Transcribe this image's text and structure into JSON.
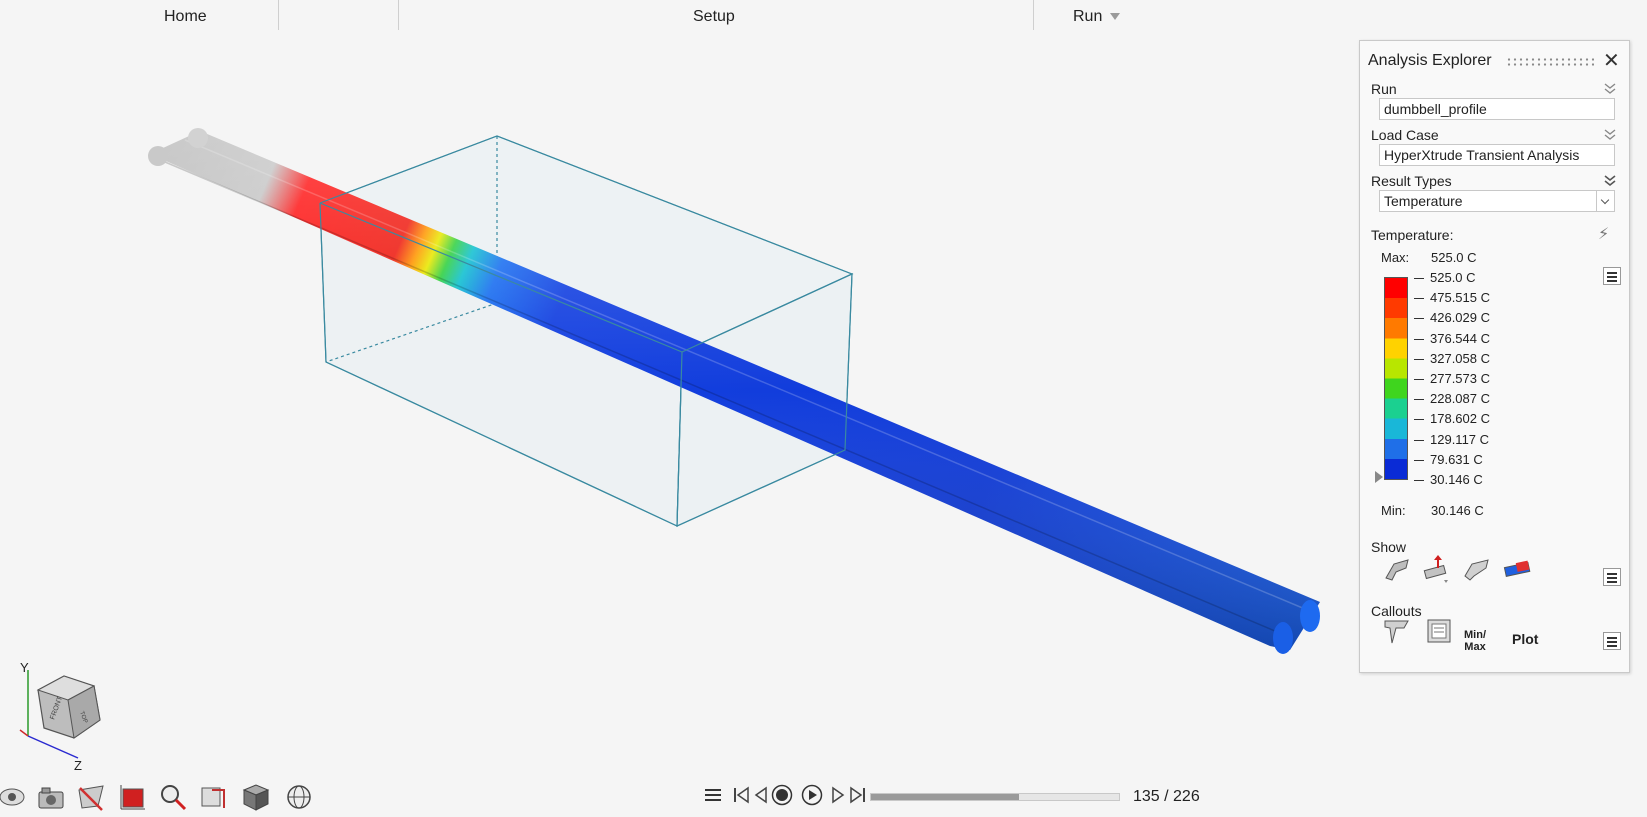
{
  "menu": {
    "home": "Home",
    "setup": "Setup",
    "run": "Run"
  },
  "explorer": {
    "title": "Analysis Explorer",
    "run_label": "Run",
    "run_value": "dumbbell_profile",
    "loadcase_label": "Load Case",
    "loadcase_value": "HyperXtrude Transient Analysis",
    "resulttypes_label": "Result Types",
    "resulttype_value": "Temperature",
    "legend": {
      "title": "Temperature:",
      "max_label": "Max:",
      "max_value": "525.0 C",
      "min_label": "Min:",
      "min_value": "30.146 C",
      "ticks": [
        "525.0 C",
        "475.515 C",
        "426.029 C",
        "376.544 C",
        "327.058 C",
        "277.573 C",
        "228.087 C",
        "178.602 C",
        "129.117 C",
        "79.631 C",
        "30.146 C"
      ],
      "colors": [
        "#ff0000",
        "#ff3a00",
        "#ff7a00",
        "#ffd200",
        "#b8e600",
        "#3fd51e",
        "#1bd090",
        "#19b7d8",
        "#1f6fe8",
        "#0a2bd6"
      ]
    },
    "show_label": "Show",
    "callouts_label": "Callouts",
    "callouts": {
      "minmax": "Min/\nMax",
      "plot": "Plot"
    }
  },
  "playback": {
    "current_frame": 135,
    "total_frames": 226,
    "counter_text": "135 / 226",
    "progress": 0.597
  },
  "axes": {
    "y": "Y",
    "z": "Z"
  },
  "icons": {
    "close": "close-icon",
    "lightning": "lightning-icon",
    "grip": "drag-grip-icon"
  }
}
